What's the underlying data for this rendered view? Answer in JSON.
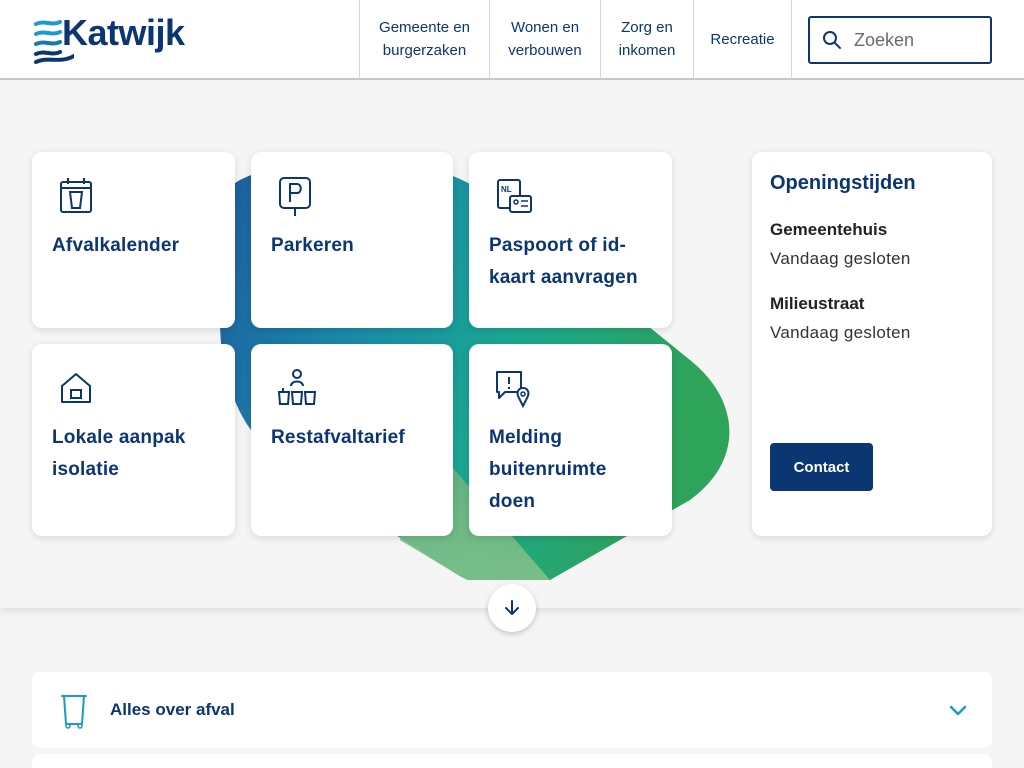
{
  "header": {
    "logo_text": "Katwijk",
    "nav": [
      {
        "label_line1": "Gemeente en",
        "label_line2": "burgerzaken"
      },
      {
        "label_line1": "Wonen en",
        "label_line2": "verbouwen"
      },
      {
        "label_line1": "Zorg en",
        "label_line2": "inkomen"
      },
      {
        "label_line1": "Recreatie",
        "label_line2": ""
      }
    ],
    "search_placeholder": "Zoeken"
  },
  "cards": [
    {
      "label": "Afvalkalender",
      "icon": "calendar-bin-icon"
    },
    {
      "label": "Parkeren",
      "icon": "parking-sign-icon"
    },
    {
      "label": "Paspoort of id-kaart aanvragen",
      "icon": "passport-id-icon"
    },
    {
      "label": "Lokale aanpak isolatie",
      "icon": "house-icon"
    },
    {
      "label": "Restafvaltarief",
      "icon": "waste-bins-person-icon"
    },
    {
      "label": "Melding buitenruimte doen",
      "icon": "report-location-icon"
    }
  ],
  "hours": {
    "title": "Openingstijden",
    "locations": [
      {
        "name": "Gemeentehuis",
        "status": "Vandaag gesloten"
      },
      {
        "name": "Milieustraat",
        "status": "Vandaag gesloten"
      }
    ],
    "contact_label": "Contact"
  },
  "accordion": {
    "label": "Alles over afval",
    "icon": "waste-bin-icon"
  },
  "colors": {
    "primary": "#0b3672",
    "accent": "#1aa0c8",
    "green": "#2ea35a",
    "background": "#f5f5f5"
  }
}
